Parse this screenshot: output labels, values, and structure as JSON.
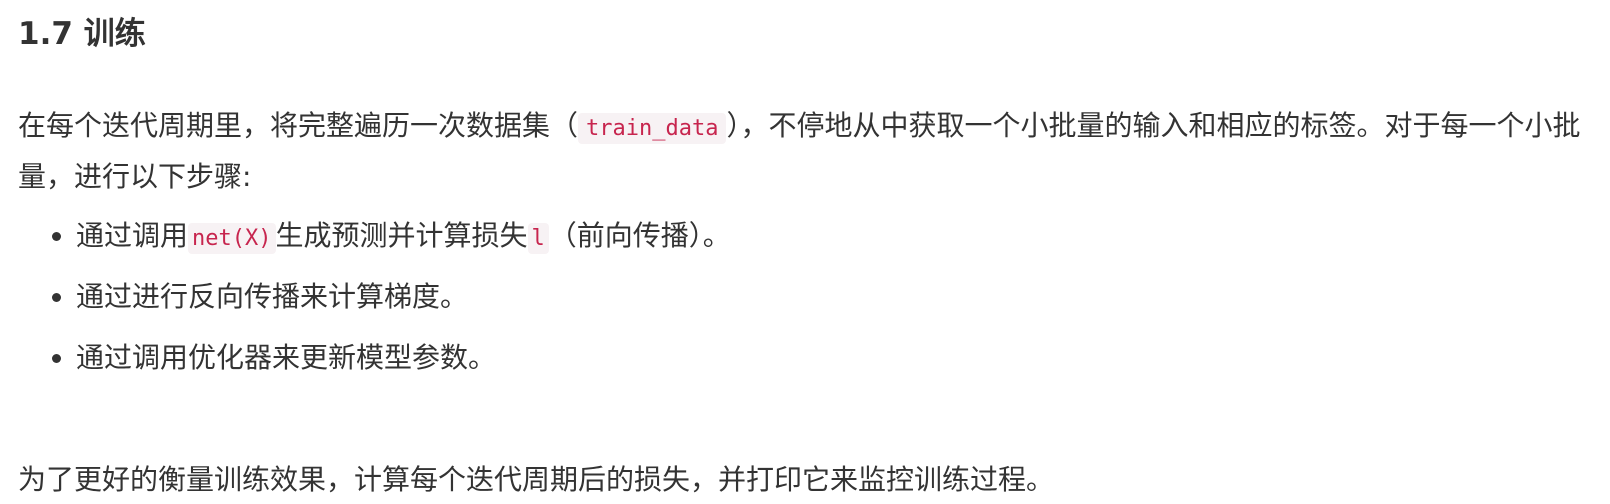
{
  "heading": "1.7 训练",
  "intro": {
    "text_before": "在每个迭代周期里，将完整遍历一次数据集（",
    "code": "train_data",
    "text_after": "），不停地从中获取一个小批量的输入和相应的标签。对于每一个小批量，进行以下步骤:"
  },
  "steps": [
    {
      "text_before": "通过调用",
      "code": "net(X)",
      "text_middle": "生成预测并计算损失",
      "code2": "l",
      "text_after": "（前向传播）。"
    },
    {
      "text": "通过进行反向传播来计算梯度。"
    },
    {
      "text": "通过调用优化器来更新模型参数。"
    }
  ],
  "closing": "为了更好的衡量训练效果，计算每个迭代周期后的损失，并打印它来监控训练过程。"
}
